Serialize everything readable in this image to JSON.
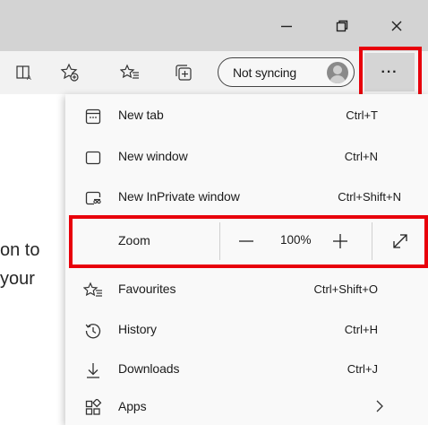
{
  "window_controls": {
    "minimize_icon": "minimize-icon",
    "restore_icon": "restore-icon",
    "close_icon": "close-icon"
  },
  "toolbar": {
    "sync_label": "Not syncing",
    "more_label": "···"
  },
  "page": {
    "line1": "on to",
    "line2": "your "
  },
  "menu": {
    "items": [
      {
        "label": "New tab",
        "shortcut": "Ctrl+T",
        "icon": "new-tab-icon"
      },
      {
        "label": "New window",
        "shortcut": "Ctrl+N",
        "icon": "new-window-icon"
      },
      {
        "label": "New InPrivate window",
        "shortcut": "Ctrl+Shift+N",
        "icon": "inprivate-icon"
      }
    ],
    "zoom": {
      "label": "Zoom",
      "value": "100%",
      "minus": "—",
      "plus": "+"
    },
    "items_after": [
      {
        "label": "Favourites",
        "shortcut": "Ctrl+Shift+O",
        "icon": "favourites-icon"
      },
      {
        "label": "History",
        "shortcut": "Ctrl+H",
        "icon": "history-icon"
      },
      {
        "label": "Downloads",
        "shortcut": "Ctrl+J",
        "icon": "downloads-icon"
      },
      {
        "label": "Apps",
        "shortcut": "",
        "icon": "apps-icon"
      }
    ]
  },
  "colors": {
    "highlight": "#e8000b",
    "titlebar": "#d3d3d3",
    "menu_bg": "#f9f9f9"
  }
}
